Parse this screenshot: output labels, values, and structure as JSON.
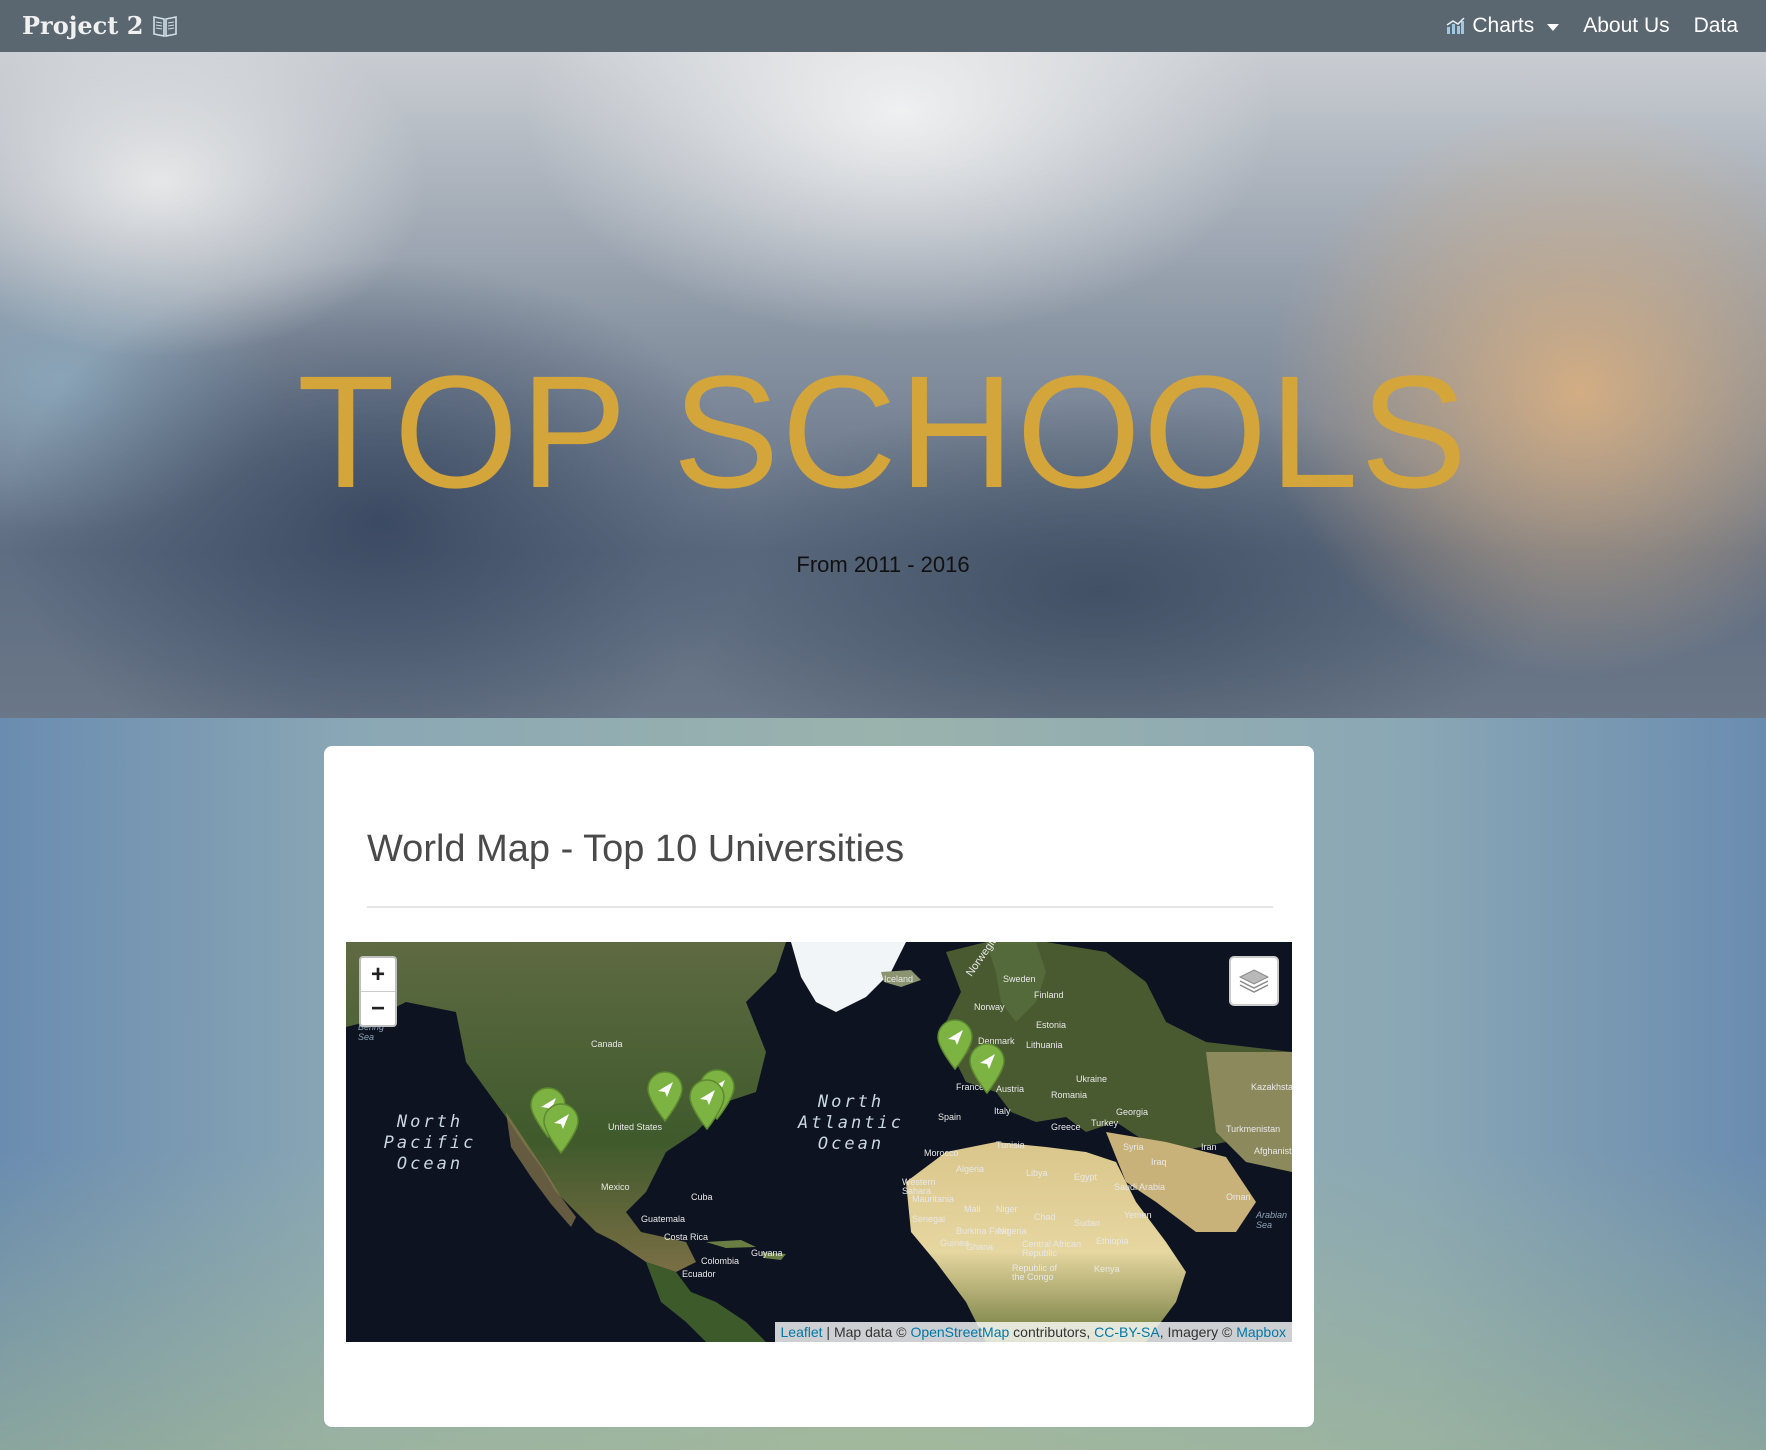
{
  "navbar": {
    "brand": "Project 2",
    "items": [
      {
        "label": "Charts",
        "has_dropdown": true,
        "icon": "chart-icon"
      },
      {
        "label": "About Us"
      },
      {
        "label": "Data"
      }
    ]
  },
  "hero": {
    "title": "TOP SCHOOLS",
    "subtitle": "From 2011 - 2016"
  },
  "card": {
    "title": "World Map - Top 10 Universities"
  },
  "map": {
    "zoom_in": "+",
    "zoom_out": "−",
    "oceans": [
      "North Pacific Ocean",
      "North Atlantic Ocean"
    ],
    "labels": [
      "Bering Sea",
      "Canada",
      "United States",
      "Mexico",
      "Cuba",
      "Guatemala",
      "Costa Rica",
      "Colombia",
      "Guyana",
      "Ecuador",
      "Iceland",
      "Norway",
      "Sweden",
      "Finland",
      "Estonia",
      "Lithuania",
      "Denmark",
      "France",
      "Austria",
      "Italy",
      "Spain",
      "Romania",
      "Ukraine",
      "Greece",
      "Turkey",
      "Georgia",
      "Morocco",
      "Algeria",
      "Tunisia",
      "Libya",
      "Egypt",
      "Saudi Arabia",
      "Yemen",
      "Mauritania",
      "Mali",
      "Niger",
      "Chad",
      "Sudan",
      "Ethiopia",
      "Senegal",
      "Burkina Faso",
      "Nigeria",
      "Ghana",
      "Central African Republic",
      "Republic of the Congo",
      "Kenya",
      "Iran",
      "Iraq",
      "Syria",
      "Oman",
      "Turkmenistan",
      "Kazakhstan",
      "Afghanistan",
      "Arabian Sea",
      "Western Sahara",
      "Guinea",
      "Norwegian Sea"
    ],
    "attribution": {
      "leaflet": "Leaflet",
      "sep": " | Map data © ",
      "osm": "OpenStreetMap",
      "contrib": " contributors, ",
      "license": "CC-BY-SA",
      "imagery": ", Imagery © ",
      "mapbox": "Mapbox"
    },
    "marker_color": "#7cb342"
  }
}
